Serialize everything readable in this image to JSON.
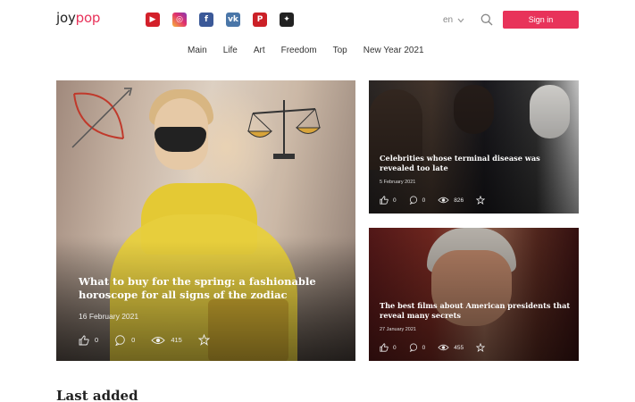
{
  "header": {
    "logo_prefix": "joy",
    "logo_suffix": "pop",
    "socials": [
      "youtube-icon",
      "instagram-icon",
      "facebook-icon",
      "vk-icon",
      "pinterest-icon",
      "other-icon"
    ],
    "lang": "en",
    "signin_label": "Sign in",
    "accent": "#e8335a"
  },
  "nav": {
    "items": [
      "Main",
      "Life",
      "Art",
      "Freedom",
      "Top",
      "New Year 2021"
    ]
  },
  "featured": {
    "title": "What to buy for the spring: a fashionable horoscope for all signs of the zodiac",
    "date": "16 February 2021",
    "likes": "0",
    "comments": "0",
    "views": "415"
  },
  "side_cards": [
    {
      "title": "Celebrities whose terminal disease was revealed too late",
      "date": "5 February 2021",
      "likes": "0",
      "comments": "0",
      "views": "826"
    },
    {
      "title": "The best films about American presidents that reveal many secrets",
      "date": "27 January 2021",
      "likes": "0",
      "comments": "0",
      "views": "455"
    }
  ],
  "section_title": "Last added"
}
